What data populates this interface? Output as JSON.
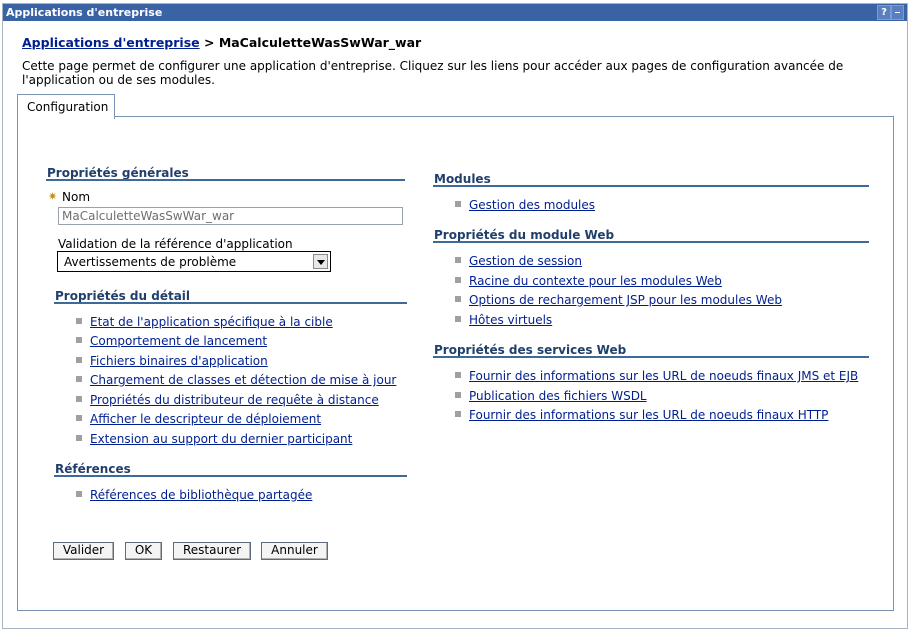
{
  "window": {
    "title": "Applications d'entreprise",
    "help_label": "?"
  },
  "breadcrumb": {
    "link": "Applications d'entreprise",
    "separator": ">",
    "current": "MaCalculetteWasSwWar_war"
  },
  "description": "Cette page permet de configurer une application d'entreprise. Cliquez sur les liens pour accéder aux pages de configuration avancée de l'application ou de ses modules.",
  "tab": {
    "label": "Configuration"
  },
  "general": {
    "title": "Propriétés générales",
    "required_marker": "✷",
    "name_label": "Nom",
    "name_value": "MaCalculetteWasSwWar_war",
    "validation_label": "Validation de la référence d'application",
    "validation_value": "Avertissements de problème"
  },
  "detail": {
    "title": "Propriétés du détail",
    "links": [
      "Etat de l'application spécifique à la cible",
      "Comportement de lancement",
      "Fichiers binaires d'application",
      "Chargement de classes et détection de mise à jour",
      "Propriétés du distributeur de requête à distance",
      "Afficher le descripteur de déploiement",
      "Extension au support du dernier participant"
    ]
  },
  "references": {
    "title": "Références",
    "links": [
      "Références de bibliothèque partagée"
    ]
  },
  "modules": {
    "title": "Modules",
    "links": [
      "Gestion des modules"
    ]
  },
  "web_module": {
    "title": "Propriétés du module Web",
    "links": [
      "Gestion de session",
      "Racine du contexte pour les modules Web",
      "Options de rechargement JSP pour les modules Web",
      "Hôtes virtuels"
    ]
  },
  "web_services": {
    "title": "Propriétés des services Web",
    "links": [
      "Fournir des informations sur les URL de noeuds finaux JMS et EJB",
      "Publication des fichiers WSDL",
      "Fournir des informations sur les URL de noeuds finaux HTTP"
    ]
  },
  "buttons": {
    "validate": "Valider",
    "ok": "OK",
    "reset": "Restaurer",
    "cancel": "Annuler"
  }
}
